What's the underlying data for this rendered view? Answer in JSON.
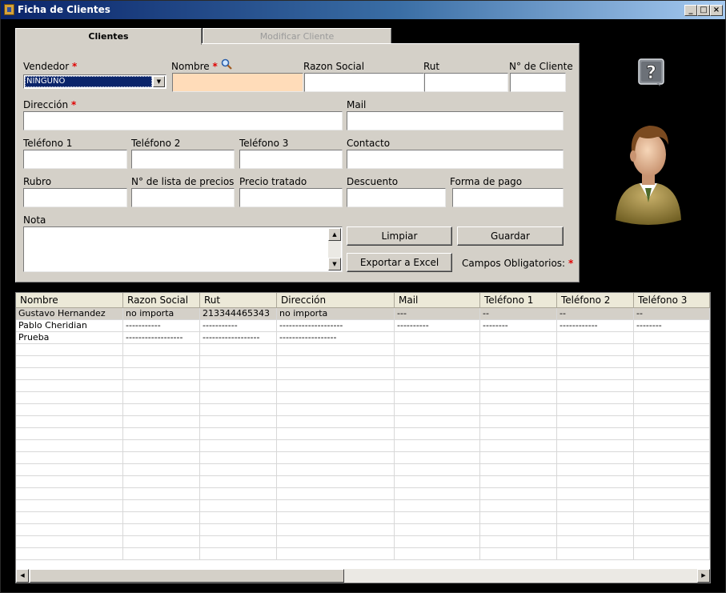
{
  "window": {
    "title": "Ficha de Clientes"
  },
  "tabs": [
    {
      "label": "Clientes"
    },
    {
      "label": "Modificar Cliente"
    }
  ],
  "form": {
    "vendedor": {
      "label": "Vendedor",
      "value": "NINGUNO"
    },
    "nombre": {
      "label": "Nombre"
    },
    "razon_social": {
      "label": "Razon Social"
    },
    "rut": {
      "label": "Rut"
    },
    "n_cliente": {
      "label": "N° de Cliente"
    },
    "direccion": {
      "label": "Dirección"
    },
    "mail": {
      "label": "Mail"
    },
    "telefono1": {
      "label": "Teléfono 1"
    },
    "telefono2": {
      "label": "Teléfono 2"
    },
    "telefono3": {
      "label": "Teléfono 3"
    },
    "contacto": {
      "label": "Contacto"
    },
    "rubro": {
      "label": "Rubro"
    },
    "lista_precios": {
      "label": "N° de lista de precios"
    },
    "precio_tratado": {
      "label": "Precio tratado"
    },
    "descuento": {
      "label": "Descuento"
    },
    "forma_pago": {
      "label": "Forma de pago"
    },
    "nota": {
      "label": "Nota"
    },
    "required_mark": "*",
    "required_note": "Campos Obligatorios:"
  },
  "buttons": {
    "limpiar": "Limpiar",
    "guardar": "Guardar",
    "exportar": "Exportar a Excel"
  },
  "table": {
    "columns": [
      "Nombre",
      "Razon Social",
      "Rut",
      "Dirección",
      "Mail",
      "Teléfono 1",
      "Teléfono 2",
      "Teléfono 3"
    ],
    "rows": [
      [
        "Gustavo Hernandez",
        "no importa",
        "213344465343",
        "no importa",
        "---",
        "--",
        "--",
        "--"
      ],
      [
        "Pablo Cheridian",
        "-----------",
        "-----------",
        "--------------------",
        "----------",
        "--------",
        "------------",
        "--------"
      ],
      [
        "Prueba",
        "------------------",
        "------------------",
        "------------------",
        "",
        "",
        "",
        ""
      ]
    ]
  },
  "icons": {
    "help": "help-question-icon",
    "search": "search-icon",
    "avatar": "user-avatar-icon"
  },
  "colors": {
    "highlight_field": "#ffdcb9",
    "required": "#e00000",
    "titlebar": "#0a246a"
  }
}
